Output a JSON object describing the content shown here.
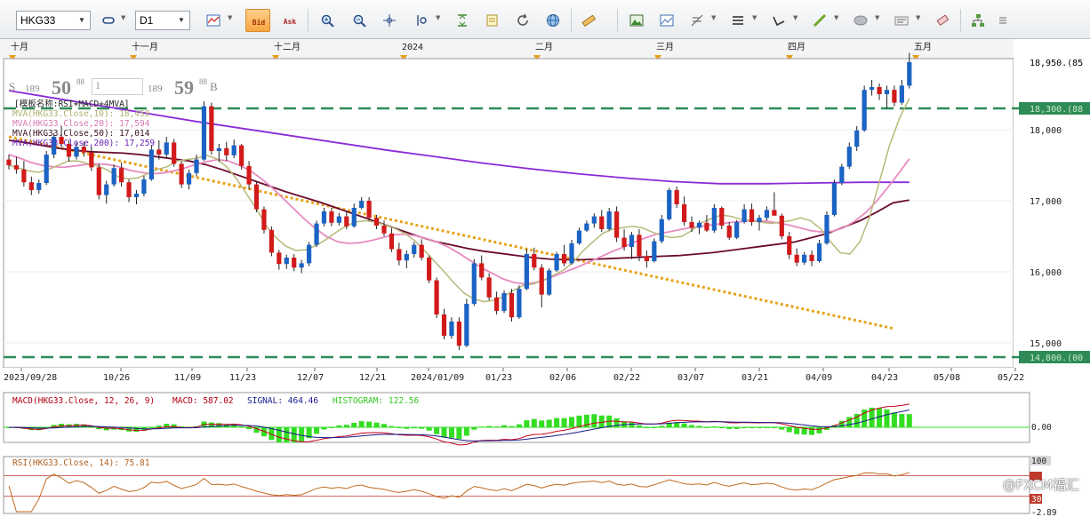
{
  "toolbar": {
    "symbol": "HKG33",
    "timeframe": "D1",
    "bid_label": "Bid",
    "ask_label": "Ask",
    "icons": [
      "chart-type-icon",
      "bar-icon",
      "bid-icon",
      "ask-icon",
      "zoom-in-icon",
      "zoom-out-icon",
      "crosshair-icon",
      "cursor-text-icon",
      "fit-vertical-icon",
      "notes-icon",
      "refresh-icon",
      "globe-icon",
      "ruler-icon",
      "image-icon",
      "template-icon",
      "fibonacci-icon",
      "lines-icon",
      "trend-icon",
      "pencil-icon",
      "ellipse-icon",
      "text-icon",
      "eraser-icon",
      "tree-icon",
      "menu-icon"
    ]
  },
  "quote": {
    "sell_label": "S",
    "sell_prefix": "189",
    "sell_big": "50",
    "sell_sup": "88",
    "lot": "1",
    "buy_prefix": "189",
    "buy_big": "59",
    "buy_sup": "88",
    "buy_label": "B"
  },
  "month_labels": [
    "十月",
    "十一月",
    "十二月",
    "2024",
    "二月",
    "三月",
    "四月",
    "五月"
  ],
  "date_labels": [
    "2023/09/28",
    "10/26",
    "11/09",
    "11/23",
    "12/07",
    "12/21",
    "2024/01/09",
    "01/23",
    "02/06",
    "02/22",
    "03/07",
    "03/21",
    "04/09",
    "04/23",
    "05/08",
    "05/22"
  ],
  "legend": {
    "template": "[模板名称:RSI+MACD+4MVA]",
    "lines": [
      "MVA(HKG33.Close,10): 18,458",
      "MVA(HKG33.Close,20): 17,594",
      "MVA(HKG33.Close,50): 17,014",
      "MVA(HKG33.Close,200): 17,259"
    ]
  },
  "price_axis": {
    "ticks": [
      "18,000",
      "17,000",
      "16,000",
      "15,000"
    ],
    "last_price_tag": "18,950.(85",
    "upper_line_tag": "18,300.(88",
    "lower_line_tag": "14,800.(00"
  },
  "macd": {
    "label": "MACD(HKG33.Close, 12, 26, 9)",
    "value_label": "MACD: 587.02",
    "signal_label": "SIGNAL: 464.46",
    "hist_label": "HISTOGRAM: 122.56",
    "zero_tick": "0.00"
  },
  "rsi": {
    "label": "RSI(HKG33.Close, 14): 75.81",
    "tick_top": "100",
    "tick_mid": "30",
    "tick_low": "-2.89"
  },
  "watermark": "@FXCM福汇",
  "colors": {
    "bull": "#1b63c4",
    "bear": "#d21a1a",
    "mva10": "#b8b87a",
    "mva20": "#e78bc0",
    "mva50": "#6b0b2b",
    "mva200": "#8a2bd8",
    "trend": "#e8a317",
    "hline": "#2e8b57",
    "macd_line": "#c8001c",
    "signal_line": "#1a1a8c",
    "histogram": "#33dd22",
    "rsi_line": "#c06a1e"
  },
  "chart_data": {
    "type": "candlestick",
    "symbol": "HKG33",
    "y_range": [
      14650,
      19000
    ],
    "start_date": "2023/09/25",
    "candles": [
      [
        17580,
        17650,
        17440,
        17500
      ],
      [
        17500,
        17620,
        17380,
        17440
      ],
      [
        17440,
        17560,
        17200,
        17260
      ],
      [
        17260,
        17340,
        17080,
        17150
      ],
      [
        17150,
        17300,
        17100,
        17250
      ],
      [
        17250,
        17700,
        17220,
        17650
      ],
      [
        17650,
        17950,
        17600,
        17900
      ],
      [
        17900,
        18050,
        17760,
        17800
      ],
      [
        17800,
        17850,
        17550,
        17620
      ],
      [
        17620,
        17820,
        17580,
        17760
      ],
      [
        17760,
        17830,
        17620,
        17680
      ],
      [
        17680,
        17760,
        17420,
        17470
      ],
      [
        17470,
        17520,
        17020,
        17080
      ],
      [
        17080,
        17280,
        16960,
        17230
      ],
      [
        17230,
        17510,
        17200,
        17460
      ],
      [
        17460,
        17540,
        17200,
        17260
      ],
      [
        17260,
        17300,
        16980,
        17050
      ],
      [
        17050,
        17150,
        16950,
        17100
      ],
      [
        17100,
        17350,
        17060,
        17300
      ],
      [
        17300,
        17780,
        17280,
        17720
      ],
      [
        17720,
        17850,
        17580,
        17650
      ],
      [
        17650,
        17900,
        17600,
        17820
      ],
      [
        17820,
        17870,
        17480,
        17520
      ],
      [
        17520,
        17560,
        17180,
        17230
      ],
      [
        17230,
        17440,
        17160,
        17390
      ],
      [
        17390,
        17650,
        17340,
        17580
      ],
      [
        17580,
        18400,
        17560,
        18330
      ],
      [
        18330,
        18380,
        17650,
        17700
      ],
      [
        17700,
        17800,
        17550,
        17740
      ],
      [
        17740,
        17830,
        17560,
        17640
      ],
      [
        17640,
        17860,
        17600,
        17780
      ],
      [
        17780,
        17800,
        17440,
        17490
      ],
      [
        17490,
        17560,
        17160,
        17230
      ],
      [
        17230,
        17280,
        16840,
        16880
      ],
      [
        16880,
        16920,
        16540,
        16590
      ],
      [
        16590,
        16640,
        16220,
        16270
      ],
      [
        16270,
        16310,
        16030,
        16110
      ],
      [
        16110,
        16240,
        16040,
        16200
      ],
      [
        16200,
        16250,
        16010,
        16060
      ],
      [
        16060,
        16170,
        15980,
        16120
      ],
      [
        16120,
        16420,
        16080,
        16380
      ],
      [
        16380,
        16720,
        16350,
        16680
      ],
      [
        16680,
        16900,
        16640,
        16850
      ],
      [
        16850,
        16900,
        16640,
        16690
      ],
      [
        16690,
        16830,
        16650,
        16780
      ],
      [
        16780,
        16860,
        16600,
        16640
      ],
      [
        16640,
        16960,
        16620,
        16900
      ],
      [
        16900,
        17050,
        16880,
        17000
      ],
      [
        17000,
        17050,
        16720,
        16760
      ],
      [
        16760,
        16800,
        16600,
        16650
      ],
      [
        16650,
        16720,
        16500,
        16540
      ],
      [
        16540,
        16620,
        16280,
        16320
      ],
      [
        16320,
        16410,
        16090,
        16160
      ],
      [
        16160,
        16300,
        16050,
        16250
      ],
      [
        16250,
        16420,
        16200,
        16380
      ],
      [
        16380,
        16460,
        16160,
        16200
      ],
      [
        16200,
        16230,
        15840,
        15880
      ],
      [
        15880,
        15920,
        15350,
        15400
      ],
      [
        15400,
        15480,
        15050,
        15100
      ],
      [
        15100,
        15360,
        15060,
        15300
      ],
      [
        15300,
        15360,
        14900,
        14960
      ],
      [
        14960,
        15620,
        14940,
        15550
      ],
      [
        15550,
        16180,
        15520,
        16120
      ],
      [
        16120,
        16230,
        15880,
        15920
      ],
      [
        15920,
        15980,
        15600,
        15640
      ],
      [
        15640,
        15720,
        15400,
        15450
      ],
      [
        15450,
        15740,
        15420,
        15700
      ],
      [
        15700,
        15760,
        15300,
        15360
      ],
      [
        15360,
        15810,
        15340,
        15760
      ],
      [
        15760,
        16320,
        15740,
        16250
      ],
      [
        16250,
        16340,
        16020,
        16060
      ],
      [
        16060,
        16110,
        15500,
        15680
      ],
      [
        15680,
        16050,
        15660,
        16020
      ],
      [
        16020,
        16280,
        16000,
        16250
      ],
      [
        16250,
        16380,
        16080,
        16120
      ],
      [
        16120,
        16450,
        16100,
        16400
      ],
      [
        16400,
        16620,
        16380,
        16580
      ],
      [
        16580,
        16720,
        16560,
        16680
      ],
      [
        16680,
        16820,
        16620,
        16780
      ],
      [
        16780,
        16870,
        16560,
        16600
      ],
      [
        16600,
        16900,
        16580,
        16850
      ],
      [
        16850,
        16920,
        16420,
        16480
      ],
      [
        16480,
        16600,
        16300,
        16350
      ],
      [
        16350,
        16560,
        16180,
        16520
      ],
      [
        16520,
        16600,
        16150,
        16220
      ],
      [
        16220,
        16300,
        16060,
        16150
      ],
      [
        16150,
        16470,
        16130,
        16430
      ],
      [
        16430,
        16800,
        16400,
        16740
      ],
      [
        16740,
        17180,
        16720,
        17150
      ],
      [
        17150,
        17200,
        16900,
        16950
      ],
      [
        16950,
        17060,
        16650,
        16700
      ],
      [
        16700,
        16780,
        16560,
        16620
      ],
      [
        16620,
        16720,
        16530,
        16690
      ],
      [
        16690,
        16800,
        16560,
        16580
      ],
      [
        16580,
        16950,
        16550,
        16900
      ],
      [
        16900,
        16920,
        16600,
        16650
      ],
      [
        16650,
        16700,
        16450,
        16480
      ],
      [
        16480,
        16730,
        16460,
        16700
      ],
      [
        16700,
        16950,
        16680,
        16880
      ],
      [
        16880,
        16960,
        16650,
        16700
      ],
      [
        16700,
        16800,
        16580,
        16760
      ],
      [
        16760,
        16920,
        16720,
        16870
      ],
      [
        16870,
        17120,
        16840,
        16790
      ],
      [
        16790,
        16820,
        16460,
        16500
      ],
      [
        16500,
        16560,
        16180,
        16240
      ],
      [
        16240,
        16330,
        16080,
        16130
      ],
      [
        16130,
        16280,
        16100,
        16240
      ],
      [
        16240,
        16300,
        16080,
        16150
      ],
      [
        16150,
        16450,
        16130,
        16400
      ],
      [
        16400,
        16850,
        16380,
        16800
      ],
      [
        16800,
        17300,
        16780,
        17250
      ],
      [
        17250,
        17520,
        17220,
        17480
      ],
      [
        17480,
        17820,
        17450,
        17760
      ],
      [
        17760,
        18050,
        17700,
        17990
      ],
      [
        17990,
        18620,
        17970,
        18560
      ],
      [
        18560,
        18700,
        18480,
        18600
      ],
      [
        18600,
        18650,
        18420,
        18500
      ],
      [
        18500,
        18620,
        18300,
        18560
      ],
      [
        18560,
        18620,
        18330,
        18380
      ],
      [
        18380,
        18700,
        18350,
        18620
      ],
      [
        18620,
        19080,
        18580,
        18950
      ]
    ],
    "mva10": [
      17500,
      17460,
      17420,
      17400,
      17440,
      17500,
      17560,
      17560,
      17520,
      17490,
      17430,
      17340,
      17310,
      17320,
      17380,
      17440,
      17480,
      17560,
      17580,
      17600,
      17640,
      17590,
      17480,
      17310,
      17100,
      16890,
      16650,
      16480,
      16360,
      16300,
      16310,
      16370,
      16450,
      16550,
      16640,
      16700,
      16720,
      16700,
      16660,
      16610,
      16540,
      16440,
      16300,
      16150,
      16000,
      15840,
      15700,
      15620,
      15580,
      15600,
      15650,
      15740,
      15810,
      15830,
      15880,
      15950,
      16020,
      16130,
      16290,
      16420,
      16540,
      16600,
      16620,
      16640,
      16620,
      16560,
      16510,
      16480,
      16500,
      16580,
      16690,
      16750,
      16800,
      16780,
      16740,
      16720,
      16700,
      16680,
      16700,
      16720,
      16760,
      16720,
      16610,
      16430,
      16270,
      16250,
      16420,
      16780,
      17280,
      17780,
      18160,
      18440
    ],
    "mva20": [
      17650,
      17600,
      17540,
      17500,
      17480,
      17470,
      17490,
      17510,
      17520,
      17510,
      17480,
      17430,
      17400,
      17380,
      17390,
      17420,
      17460,
      17510,
      17550,
      17580,
      17560,
      17500,
      17420,
      17310,
      17180,
      17030,
      16880,
      16730,
      16600,
      16490,
      16420,
      16400,
      16410,
      16440,
      16480,
      16520,
      16530,
      16510,
      16470,
      16420,
      16350,
      16260,
      16160,
      16060,
      15980,
      15900,
      15850,
      15830,
      15850,
      15900,
      15960,
      16020,
      16080,
      16150,
      16220,
      16290,
      16350,
      16420,
      16480,
      16530,
      16560,
      16590,
      16620,
      16640,
      16660,
      16680,
      16700,
      16710,
      16720,
      16710,
      16690,
      16660,
      16620,
      16580,
      16560,
      16570,
      16620,
      16710,
      16830,
      16990,
      17180,
      17380,
      17590
    ],
    "mva50": [
      17850,
      17820,
      17780,
      17740,
      17710,
      17690,
      17680,
      17670,
      17650,
      17620,
      17590,
      17560,
      17510,
      17440,
      17360,
      17280,
      17200,
      17120,
      17050,
      16980,
      16900,
      16820,
      16740,
      16660,
      16580,
      16500,
      16430,
      16380,
      16330,
      16290,
      16260,
      16230,
      16200,
      16180,
      16170,
      16170,
      16180,
      16190,
      16200,
      16210,
      16220,
      16230,
      16250,
      16270,
      16300,
      16330,
      16360,
      16390,
      16420,
      16480,
      16540,
      16630,
      16720,
      16840,
      16970,
      17010
    ],
    "mva200": [
      18550,
      18440,
      18330,
      18220,
      18110,
      18010,
      17910,
      17810,
      17710,
      17620,
      17530,
      17450,
      17380,
      17320,
      17270,
      17240,
      17240,
      17250,
      17260,
      17260
    ],
    "trendline": [
      [
        0,
        17900
      ],
      [
        118,
        15200
      ]
    ],
    "hlines": [
      18300,
      14800
    ],
    "macd_signal": [
      0,
      0
    ],
    "rsi_last": 75.81
  }
}
